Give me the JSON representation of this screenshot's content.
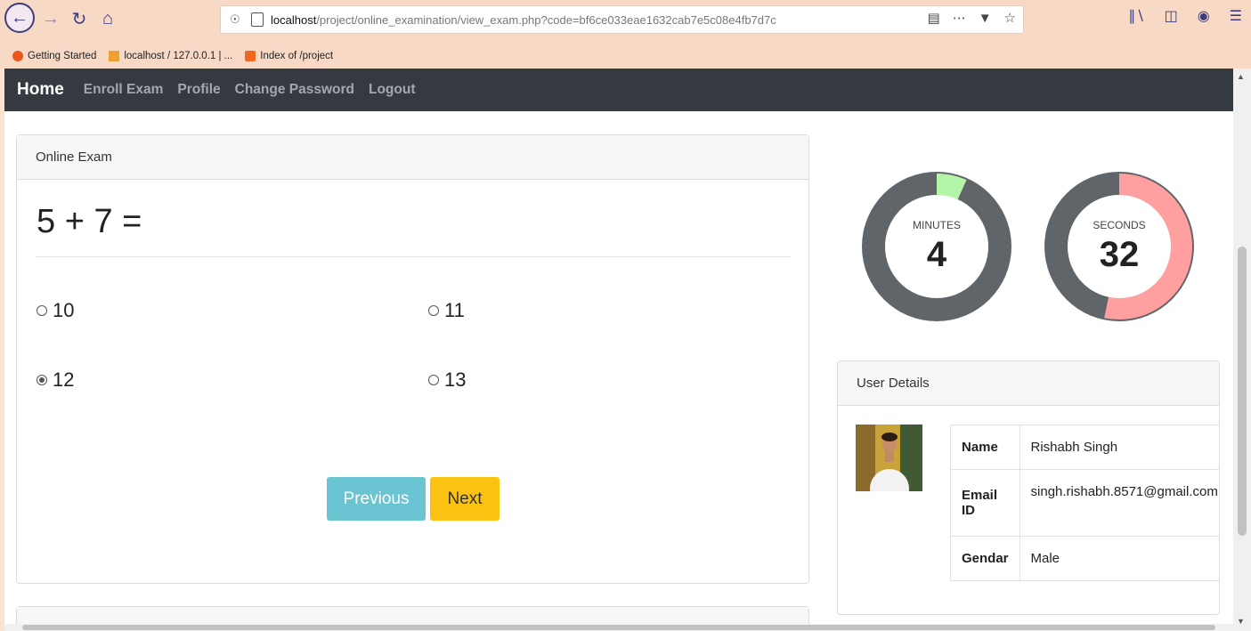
{
  "browser": {
    "url_host": "localhost",
    "url_path": "/project/online_examination/view_exam.php?code=bf6ce033eae1632cab7e5c08e4fb7d7c",
    "bookmarks": [
      "Getting Started",
      "localhost / 127.0.0.1 | ...",
      "Index of /project"
    ]
  },
  "navbar": {
    "brand": "Home",
    "links": [
      "Enroll Exam",
      "Profile",
      "Change Password",
      "Logout"
    ]
  },
  "exam": {
    "header": "Online Exam",
    "question": "5 + 7 =",
    "options": [
      {
        "label": "10",
        "checked": false
      },
      {
        "label": "11",
        "checked": false
      },
      {
        "label": "12",
        "checked": true
      },
      {
        "label": "13",
        "checked": false
      }
    ],
    "previous_label": "Previous",
    "next_label": "Next"
  },
  "timer": {
    "minutes_label": "MINUTES",
    "minutes_value": "4",
    "minutes_fraction": 0.067,
    "seconds_label": "SECONDS",
    "seconds_value": "32",
    "seconds_fraction": 0.533,
    "track_color": "#5f6569",
    "minutes_color": "#b5f5a8",
    "seconds_color": "#ff9f9f"
  },
  "user": {
    "header": "User Details",
    "rows": [
      {
        "key": "Name",
        "value": "Rishabh Singh"
      },
      {
        "key": "Email ID",
        "value": "singh.rishabh.8571@gmail.com"
      },
      {
        "key": "Gendar",
        "value": "Male"
      }
    ]
  }
}
